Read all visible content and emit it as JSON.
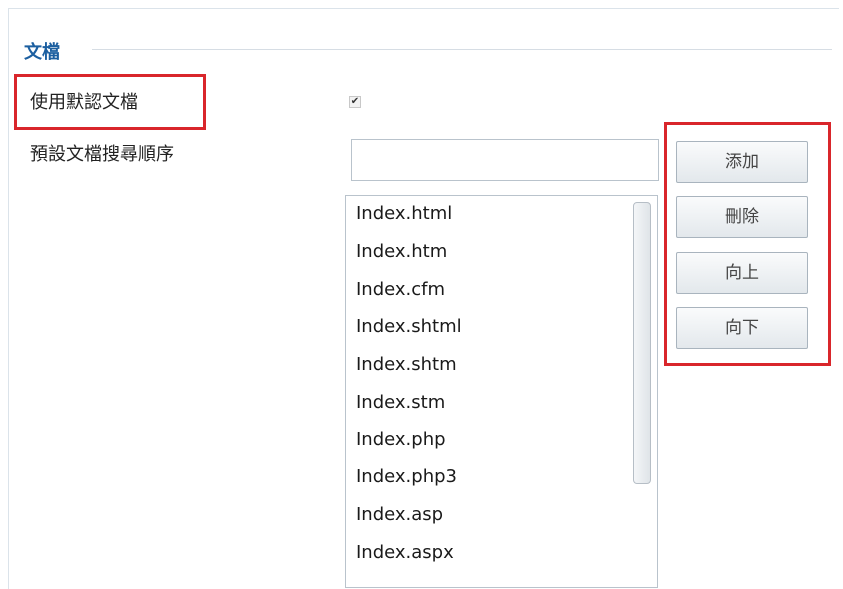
{
  "section": {
    "title": "文檔"
  },
  "fields": {
    "use_default_label": "使用默認文檔",
    "use_default_checked": "✔",
    "search_order_label": "預設文檔搜尋順序",
    "search_order_input_value": ""
  },
  "list": {
    "items": [
      "Index.html",
      "Index.htm",
      "Index.cfm",
      "Index.shtml",
      "Index.shtm",
      "Index.stm",
      "Index.php",
      "Index.php3",
      "Index.asp",
      "Index.aspx"
    ]
  },
  "buttons": {
    "add": "添加",
    "delete": "刪除",
    "up": "向上",
    "down": "向下"
  },
  "colors": {
    "highlight": "#d9262b",
    "section_title": "#1c5fa0"
  }
}
